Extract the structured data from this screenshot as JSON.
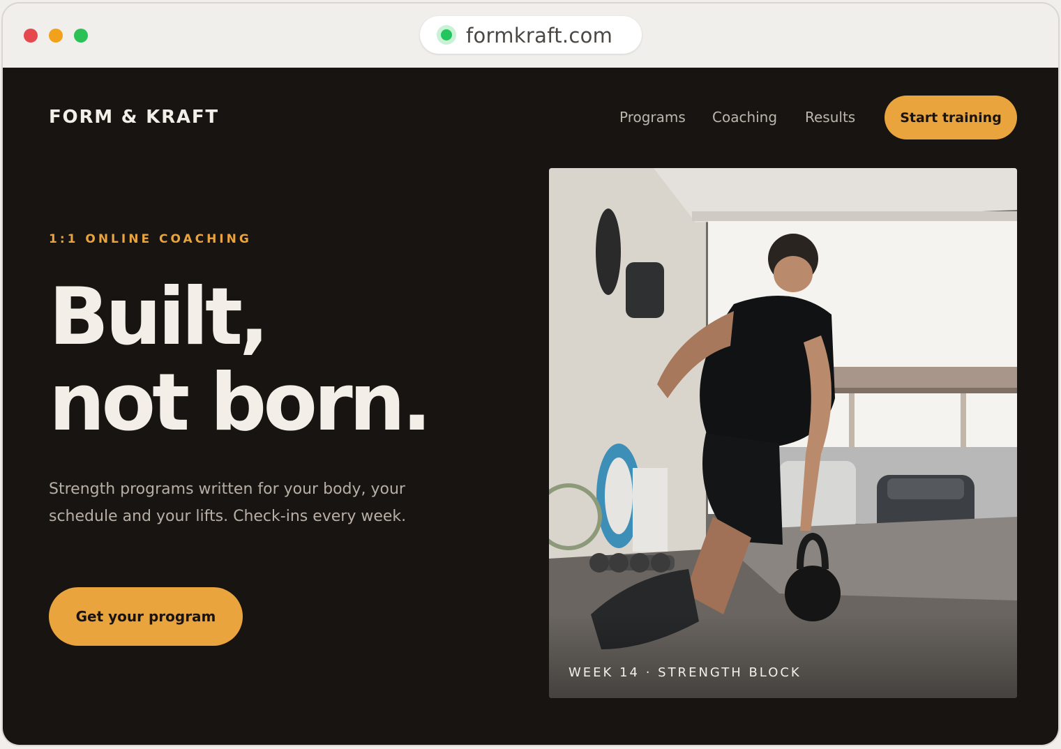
{
  "browser": {
    "url": "formkraft.com"
  },
  "header": {
    "brand": "FORM & KRAFT",
    "nav": [
      "Programs",
      "Coaching",
      "Results"
    ],
    "cta": "Start training"
  },
  "hero": {
    "eyebrow": "1:1 ONLINE COACHING",
    "headline_line1": "Built,",
    "headline_line2": "not born.",
    "subtext": "Strength programs written for your body, your schedule and your lifts. Check-ins every week.",
    "cta": "Get your program",
    "image_caption": "WEEK 14 · STRENGTH BLOCK"
  },
  "colors": {
    "background": "#181411",
    "accent": "#e9a43e",
    "text": "#f3efe8",
    "muted_text": "#b7afa5"
  }
}
